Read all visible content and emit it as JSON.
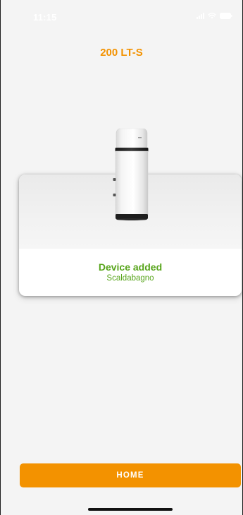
{
  "status_bar": {
    "time": "11:15",
    "icons": [
      "signal-icon",
      "wifi-icon",
      "battery-icon"
    ]
  },
  "header": {
    "title": "200 LT-S"
  },
  "device_card": {
    "image": "water-heater-image",
    "status": "Device added",
    "device_type": "Scaldabagno"
  },
  "actions": {
    "home_label": "HOME"
  },
  "colors": {
    "accent": "#f39200",
    "success": "#58a51c",
    "background": "#f4f4f4"
  }
}
